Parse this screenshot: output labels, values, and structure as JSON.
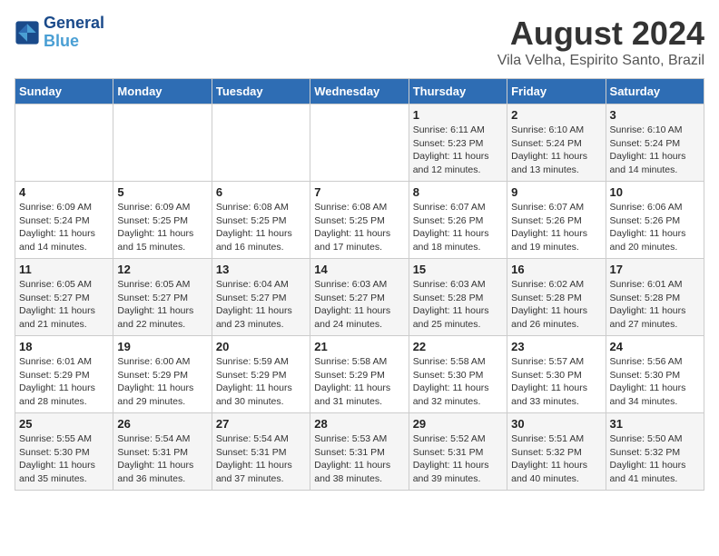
{
  "logo": {
    "line1": "General",
    "line2": "Blue"
  },
  "title": "August 2024",
  "subtitle": "Vila Velha, Espirito Santo, Brazil",
  "weekdays": [
    "Sunday",
    "Monday",
    "Tuesday",
    "Wednesday",
    "Thursday",
    "Friday",
    "Saturday"
  ],
  "weeks": [
    [
      {
        "day": "",
        "info": ""
      },
      {
        "day": "",
        "info": ""
      },
      {
        "day": "",
        "info": ""
      },
      {
        "day": "",
        "info": ""
      },
      {
        "day": "1",
        "info": "Sunrise: 6:11 AM\nSunset: 5:23 PM\nDaylight: 11 hours\nand 12 minutes."
      },
      {
        "day": "2",
        "info": "Sunrise: 6:10 AM\nSunset: 5:24 PM\nDaylight: 11 hours\nand 13 minutes."
      },
      {
        "day": "3",
        "info": "Sunrise: 6:10 AM\nSunset: 5:24 PM\nDaylight: 11 hours\nand 14 minutes."
      }
    ],
    [
      {
        "day": "4",
        "info": "Sunrise: 6:09 AM\nSunset: 5:24 PM\nDaylight: 11 hours\nand 14 minutes."
      },
      {
        "day": "5",
        "info": "Sunrise: 6:09 AM\nSunset: 5:25 PM\nDaylight: 11 hours\nand 15 minutes."
      },
      {
        "day": "6",
        "info": "Sunrise: 6:08 AM\nSunset: 5:25 PM\nDaylight: 11 hours\nand 16 minutes."
      },
      {
        "day": "7",
        "info": "Sunrise: 6:08 AM\nSunset: 5:25 PM\nDaylight: 11 hours\nand 17 minutes."
      },
      {
        "day": "8",
        "info": "Sunrise: 6:07 AM\nSunset: 5:26 PM\nDaylight: 11 hours\nand 18 minutes."
      },
      {
        "day": "9",
        "info": "Sunrise: 6:07 AM\nSunset: 5:26 PM\nDaylight: 11 hours\nand 19 minutes."
      },
      {
        "day": "10",
        "info": "Sunrise: 6:06 AM\nSunset: 5:26 PM\nDaylight: 11 hours\nand 20 minutes."
      }
    ],
    [
      {
        "day": "11",
        "info": "Sunrise: 6:05 AM\nSunset: 5:27 PM\nDaylight: 11 hours\nand 21 minutes."
      },
      {
        "day": "12",
        "info": "Sunrise: 6:05 AM\nSunset: 5:27 PM\nDaylight: 11 hours\nand 22 minutes."
      },
      {
        "day": "13",
        "info": "Sunrise: 6:04 AM\nSunset: 5:27 PM\nDaylight: 11 hours\nand 23 minutes."
      },
      {
        "day": "14",
        "info": "Sunrise: 6:03 AM\nSunset: 5:27 PM\nDaylight: 11 hours\nand 24 minutes."
      },
      {
        "day": "15",
        "info": "Sunrise: 6:03 AM\nSunset: 5:28 PM\nDaylight: 11 hours\nand 25 minutes."
      },
      {
        "day": "16",
        "info": "Sunrise: 6:02 AM\nSunset: 5:28 PM\nDaylight: 11 hours\nand 26 minutes."
      },
      {
        "day": "17",
        "info": "Sunrise: 6:01 AM\nSunset: 5:28 PM\nDaylight: 11 hours\nand 27 minutes."
      }
    ],
    [
      {
        "day": "18",
        "info": "Sunrise: 6:01 AM\nSunset: 5:29 PM\nDaylight: 11 hours\nand 28 minutes."
      },
      {
        "day": "19",
        "info": "Sunrise: 6:00 AM\nSunset: 5:29 PM\nDaylight: 11 hours\nand 29 minutes."
      },
      {
        "day": "20",
        "info": "Sunrise: 5:59 AM\nSunset: 5:29 PM\nDaylight: 11 hours\nand 30 minutes."
      },
      {
        "day": "21",
        "info": "Sunrise: 5:58 AM\nSunset: 5:29 PM\nDaylight: 11 hours\nand 31 minutes."
      },
      {
        "day": "22",
        "info": "Sunrise: 5:58 AM\nSunset: 5:30 PM\nDaylight: 11 hours\nand 32 minutes."
      },
      {
        "day": "23",
        "info": "Sunrise: 5:57 AM\nSunset: 5:30 PM\nDaylight: 11 hours\nand 33 minutes."
      },
      {
        "day": "24",
        "info": "Sunrise: 5:56 AM\nSunset: 5:30 PM\nDaylight: 11 hours\nand 34 minutes."
      }
    ],
    [
      {
        "day": "25",
        "info": "Sunrise: 5:55 AM\nSunset: 5:30 PM\nDaylight: 11 hours\nand 35 minutes."
      },
      {
        "day": "26",
        "info": "Sunrise: 5:54 AM\nSunset: 5:31 PM\nDaylight: 11 hours\nand 36 minutes."
      },
      {
        "day": "27",
        "info": "Sunrise: 5:54 AM\nSunset: 5:31 PM\nDaylight: 11 hours\nand 37 minutes."
      },
      {
        "day": "28",
        "info": "Sunrise: 5:53 AM\nSunset: 5:31 PM\nDaylight: 11 hours\nand 38 minutes."
      },
      {
        "day": "29",
        "info": "Sunrise: 5:52 AM\nSunset: 5:31 PM\nDaylight: 11 hours\nand 39 minutes."
      },
      {
        "day": "30",
        "info": "Sunrise: 5:51 AM\nSunset: 5:32 PM\nDaylight: 11 hours\nand 40 minutes."
      },
      {
        "day": "31",
        "info": "Sunrise: 5:50 AM\nSunset: 5:32 PM\nDaylight: 11 hours\nand 41 minutes."
      }
    ]
  ]
}
